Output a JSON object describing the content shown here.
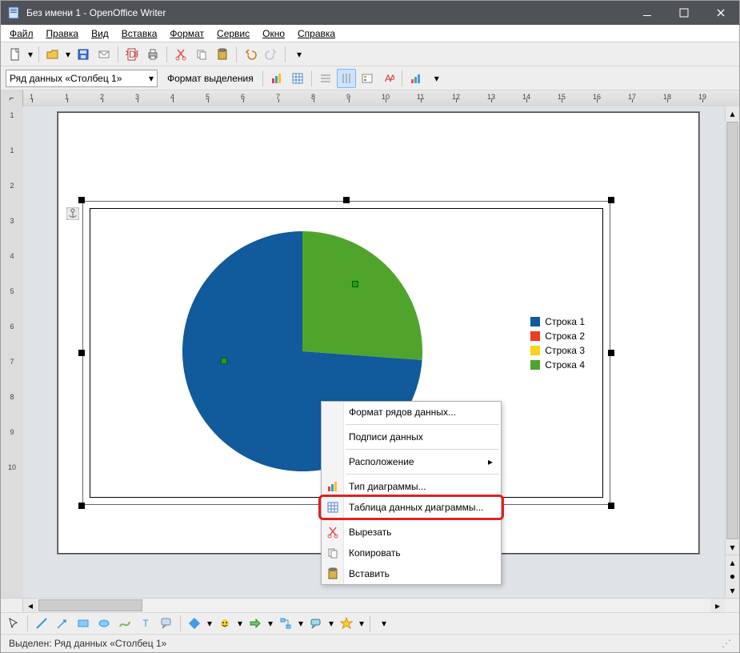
{
  "window": {
    "title": "Без имени 1 - OpenOffice Writer"
  },
  "menu": {
    "file": "Файл",
    "edit": "Правка",
    "view": "Вид",
    "insert": "Вставка",
    "format": "Формат",
    "tools": "Сервис",
    "window": "Окно",
    "help": "Справка"
  },
  "toolbar2": {
    "series_combo": "Ряд данных «Столбец 1»",
    "format_selection": "Формат выделения"
  },
  "ruler_h": [
    "1",
    "1",
    "2",
    "3",
    "4",
    "5",
    "6",
    "7",
    "8",
    "9",
    "10",
    "11",
    "12",
    "13",
    "14",
    "15",
    "16",
    "17",
    "18",
    "19"
  ],
  "ruler_v": [
    "1",
    "1",
    "2",
    "3",
    "4",
    "5",
    "6",
    "7",
    "8",
    "9",
    "10"
  ],
  "chart_data": {
    "type": "pie",
    "series_name": "Столбец 1",
    "categories": [
      "Строка 1",
      "Строка 2",
      "Строка 3",
      "Строка 4"
    ],
    "values": [
      9.1,
      0,
      0,
      3.2
    ],
    "colors": [
      "#115a9b",
      "#ef3b1f",
      "#f7d417",
      "#4fa52c"
    ]
  },
  "legend": {
    "items": [
      {
        "label": "Строка 1",
        "color": "#115a9b"
      },
      {
        "label": "Строка 2",
        "color": "#ef3b1f"
      },
      {
        "label": "Строка 3",
        "color": "#f7d417"
      },
      {
        "label": "Строка 4",
        "color": "#4fa52c"
      }
    ]
  },
  "context_menu": {
    "format_data_series": "Формат рядов данных...",
    "data_labels": "Подписи данных",
    "arrangement": "Расположение",
    "chart_type": "Тип диаграммы...",
    "chart_data_table": "Таблица данных диаграммы...",
    "cut": "Вырезать",
    "copy": "Копировать",
    "paste": "Вставить"
  },
  "status": {
    "text": "Выделен: Ряд данных «Столбец 1»"
  }
}
